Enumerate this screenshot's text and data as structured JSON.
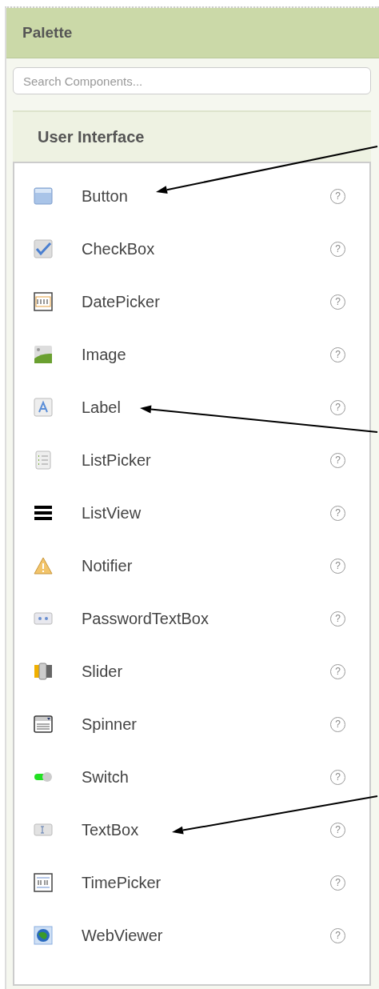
{
  "palette": {
    "title": "Palette",
    "search": {
      "placeholder": "Search Components..."
    },
    "category": {
      "title": "User Interface",
      "expanded": true
    },
    "items": [
      {
        "label": "Button",
        "help": "?"
      },
      {
        "label": "CheckBox",
        "help": "?"
      },
      {
        "label": "DatePicker",
        "help": "?"
      },
      {
        "label": "Image",
        "help": "?"
      },
      {
        "label": "Label",
        "help": "?"
      },
      {
        "label": "ListPicker",
        "help": "?"
      },
      {
        "label": "ListView",
        "help": "?"
      },
      {
        "label": "Notifier",
        "help": "?"
      },
      {
        "label": "PasswordTextBox",
        "help": "?"
      },
      {
        "label": "Slider",
        "help": "?"
      },
      {
        "label": "Spinner",
        "help": "?"
      },
      {
        "label": "Switch",
        "help": "?"
      },
      {
        "label": "TextBox",
        "help": "?"
      },
      {
        "label": "TimePicker",
        "help": "?"
      },
      {
        "label": "WebViewer",
        "help": "?"
      }
    ]
  }
}
